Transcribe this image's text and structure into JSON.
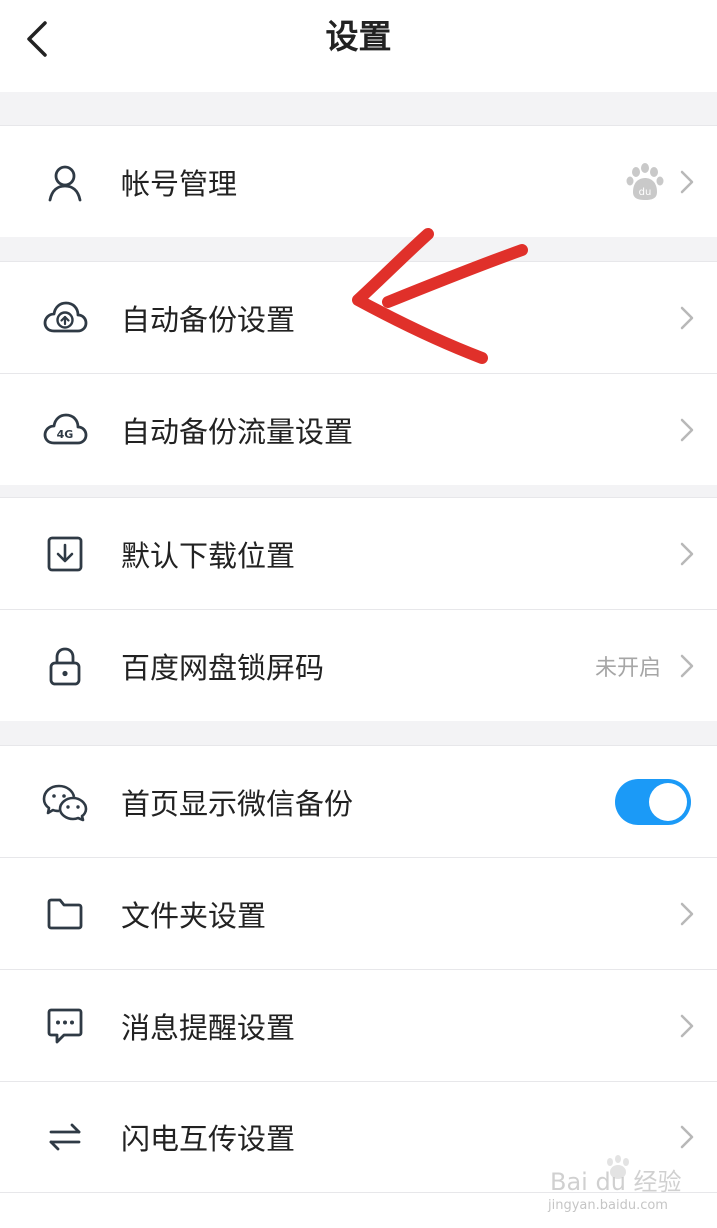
{
  "header": {
    "title": "设置"
  },
  "rows": {
    "account": {
      "label": "帐号管理"
    },
    "auto_backup": {
      "label": "自动备份设置"
    },
    "auto_backup_traffic": {
      "label": "自动备份流量设置"
    },
    "download_location": {
      "label": "默认下载位置"
    },
    "lock_screen": {
      "label": "百度网盘锁屏码",
      "value": "未开启"
    },
    "wechat_backup": {
      "label": "首页显示微信备份",
      "toggle_on": true
    },
    "folder": {
      "label": "文件夹设置"
    },
    "notification": {
      "label": "消息提醒设置"
    },
    "flash_transfer": {
      "label": "闪电互传设置"
    }
  },
  "icons": {
    "back": "chevron-left-icon",
    "account": "user-icon",
    "auto_backup": "cloud-upload-icon",
    "auto_backup_traffic": "cloud-4g-icon",
    "download_location": "download-box-icon",
    "lock_screen": "lock-icon",
    "wechat_backup": "wechat-icon",
    "folder": "folder-icon",
    "notification": "message-icon",
    "flash_transfer": "swap-arrows-icon",
    "account_badge": "baidu-paw-icon"
  },
  "cloud_badge_text": "4G",
  "baidu_badge_text": "du",
  "watermark": {
    "brand": "Bai du 经验",
    "url": "jingyan.baidu.com"
  },
  "colors": {
    "accent": "#1b9af7",
    "annotation_arrow": "#e0302a",
    "icon": "#2f3a45",
    "chevron": "#b8b8b8",
    "section_gap": "#f3f3f5"
  }
}
